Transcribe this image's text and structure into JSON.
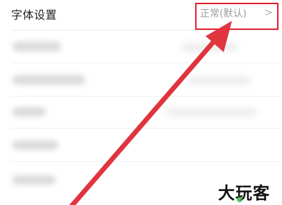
{
  "settings": {
    "font_row": {
      "label": "字体设置",
      "value": "正常(默认)",
      "chevron": ">"
    }
  },
  "annotation": {
    "color": "#e21b2c"
  },
  "watermark": {
    "text": "大玩客"
  }
}
